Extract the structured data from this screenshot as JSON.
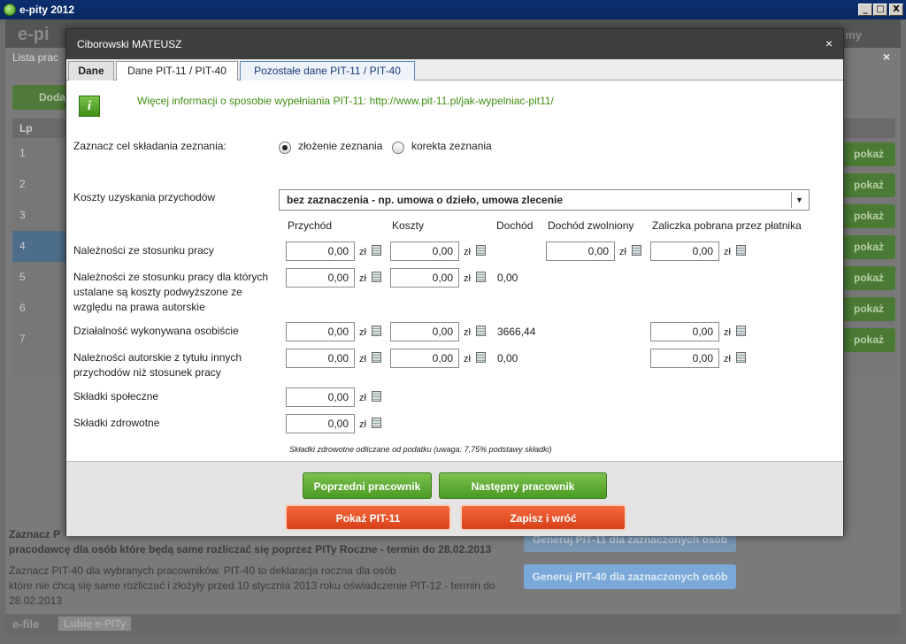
{
  "window": {
    "title": "e-pity 2012",
    "min": "_",
    "max": "□",
    "close": "X"
  },
  "background": {
    "logo": "e-pi",
    "logo_right": "ilmy",
    "panel_title": "Lista prac",
    "panel_close": "×",
    "add_label": "Doda",
    "table_header": "Lp",
    "rows": [
      "1",
      "2",
      "3",
      "4",
      "5",
      "6",
      "7"
    ],
    "pokaz_label": "pokaż",
    "pit11_text_1": "Zaznacz P",
    "pit11_text_2": "pracodawcę dla osób które będą same rozliczać się poprzez PITy Roczne - termin do 28.02.2013",
    "pit11_button": "Generuj PIT-11 dla zaznaczonych osób",
    "pit40_text_1": "Zaznacz PIT-40 dla wybranych pracowników. PIT-40 to deklaracja roczna dla osób",
    "pit40_text_2": "które nie chcą się same rozliczać i złożyły przed 10 stycznia 2013 roku oświadczenie PIT-12 - termin do",
    "pit40_text_3": "28.02.2013",
    "pit40_button": "Generuj PIT-40 dla zaznaczonych osób",
    "footer_logo": "e-file",
    "footer_like": "Lubię e-PITy"
  },
  "modal": {
    "title": "Ciborowski MATEUSZ",
    "close": "×",
    "tabs": [
      "Dane",
      "Dane PIT-11 / PIT-40",
      "Pozostałe dane PIT-11 / PIT-40"
    ],
    "info": "Więcej informacji o sposobie wypełniania PIT-11: http://www.pit-11.pl/jak-wypelniac-pit11/",
    "purpose_label": "Zaznacz cel składania zeznania:",
    "purpose_options": [
      "złożenie zeznania",
      "korekta zeznania"
    ],
    "costs_label": "Koszty uzyskania przychodów",
    "costs_value": "bez zaznaczenia - np. umowa o dzieło, umowa zlecenie",
    "columns": [
      "Przychód",
      "Koszty",
      "Dochód",
      "Dochód zwolniony",
      "Zaliczka pobrana przez płatnika"
    ],
    "currency": "zł",
    "rows": [
      {
        "label": [
          "Należności ze stosunku pracy"
        ],
        "przychod": "0,00",
        "koszty": "0,00",
        "dochod": "",
        "zwolniony": "0,00",
        "zaliczka": "0,00"
      },
      {
        "label": [
          "Należności ze stosunku pracy dla których",
          "ustalane są koszty podwyższone ze",
          "względu na prawa autorskie"
        ],
        "przychod": "0,00",
        "koszty": "0,00",
        "dochod": "0,00"
      },
      {
        "label": [
          "Działalność wykonywana osobiście"
        ],
        "przychod": "0,00",
        "koszty": "0,00",
        "dochod": "3666,44",
        "zaliczka": "0,00"
      },
      {
        "label": [
          "Należności autorskie z tytułu innych",
          "przychodów niż stosunek pracy"
        ],
        "przychod": "0,00",
        "koszty": "0,00",
        "dochod": "0,00",
        "zaliczka": "0,00"
      },
      {
        "label": [
          "Składki społeczne"
        ],
        "przychod": "0,00"
      },
      {
        "label": [
          "Składki zdrowotne"
        ],
        "przychod": "0,00"
      }
    ],
    "note": "Składki zdrowotne odliczane od podatku (uwaga: 7,75% podstawy składki)",
    "buttons": {
      "prev": "Poprzedni pracownik",
      "next": "Następny pracownik",
      "show_pit11": "Pokaż PIT-11",
      "save": "Zapisz i wróć"
    }
  }
}
